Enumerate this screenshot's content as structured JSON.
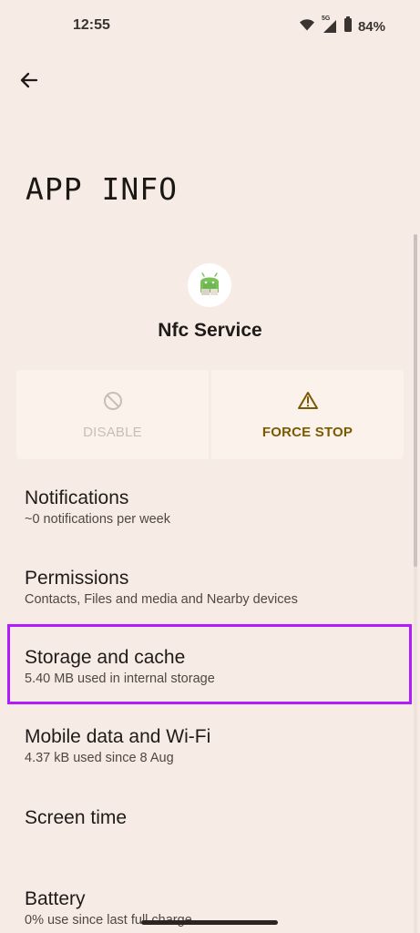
{
  "status_bar": {
    "time": "12:55",
    "signal_label": "5G",
    "battery_percent": "84%"
  },
  "page": {
    "title": "APP INFO",
    "app_name": "Nfc Service"
  },
  "actions": [
    {
      "label": "DISABLE",
      "icon": "disable-icon",
      "state": "disabled"
    },
    {
      "label": "FORCE STOP",
      "icon": "warning-icon",
      "state": "enabled"
    }
  ],
  "list": [
    {
      "title": "Notifications",
      "subtitle": "~0 notifications per week"
    },
    {
      "title": "Permissions",
      "subtitle": "Contacts, Files and media and Nearby devices"
    },
    {
      "title": "Storage and cache",
      "subtitle": "5.40 MB used in internal storage",
      "highlighted": true
    },
    {
      "title": "Mobile data and Wi-Fi",
      "subtitle": "4.37 kB used since 8 Aug"
    },
    {
      "title": "Screen time",
      "subtitle": ""
    },
    {
      "title": "Battery",
      "subtitle": "0% use since last full charge"
    }
  ],
  "colors": {
    "background": "#f7ece5",
    "accent": "#7a5a00",
    "highlight": "#b11cff",
    "android_green": "#78c257"
  }
}
